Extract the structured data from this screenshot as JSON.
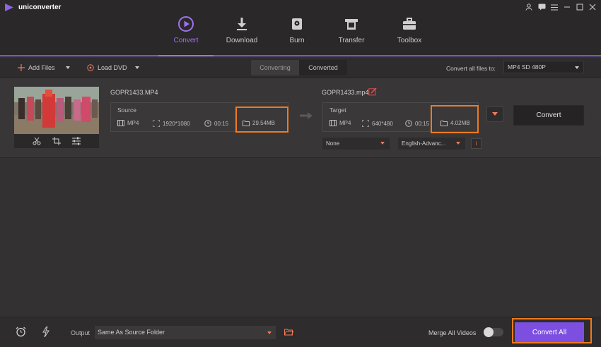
{
  "app": {
    "name": "uniconverter"
  },
  "nav": {
    "tabs": [
      {
        "label": "Convert",
        "icon": "convert-icon",
        "active": true
      },
      {
        "label": "Download",
        "icon": "download-icon"
      },
      {
        "label": "Burn",
        "icon": "burn-icon"
      },
      {
        "label": "Transfer",
        "icon": "transfer-icon"
      },
      {
        "label": "Toolbox",
        "icon": "toolbox-icon"
      }
    ]
  },
  "toolbar": {
    "add_files": "Add Files",
    "load_dvd": "Load DVD",
    "segment": {
      "converting": "Converting",
      "converted": "Converted"
    },
    "convert_all_to_label": "Convert all files to:",
    "format_value": "MP4 SD 480P"
  },
  "file": {
    "source_name": "GOPR1433.MP4",
    "target_name": "GOPR1433.mp4",
    "source": {
      "label": "Source",
      "format": "MP4",
      "resolution": "1920*1080",
      "duration": "00:15",
      "size": "29.54MB"
    },
    "target": {
      "label": "Target",
      "format": "MP4",
      "resolution": "640*480",
      "duration": "00:15",
      "size": "4.02MB"
    },
    "subtitle": "None",
    "audio": "English-Advanc...",
    "info": "i",
    "convert_label": "Convert"
  },
  "bottom": {
    "output_label": "Output",
    "output_value": "Same As Source Folder",
    "merge_label": "Merge All Videos",
    "merge_enabled": false,
    "convert_all_label": "Convert All"
  },
  "colors": {
    "accent": "#7d4fe0",
    "highlight": "#f07a1f",
    "warning": "#f07a5a"
  }
}
